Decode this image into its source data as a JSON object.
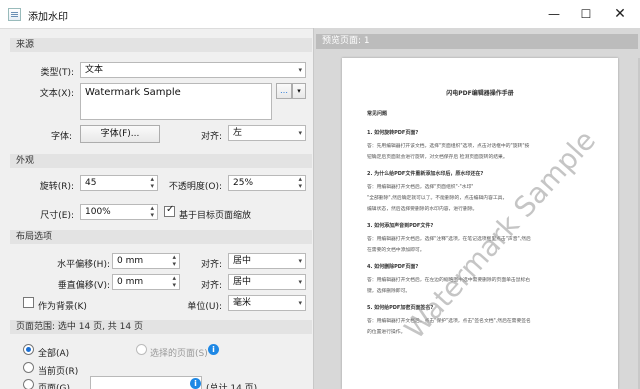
{
  "window": {
    "title": "添加水印"
  },
  "source": {
    "section": "来源",
    "type_label": "类型(T):",
    "type_value": "文本",
    "text_label": "文本(X):",
    "text_value": "Watermark Sample",
    "font_label": "字体:",
    "font_button": "字体(F)...",
    "align_label": "对齐:",
    "align_value": "左"
  },
  "appearance": {
    "section": "外观",
    "rotation_label": "旋转(R):",
    "rotation_value": "45",
    "opacity_label": "不透明度(O):",
    "opacity_value": "25%",
    "size_label": "尺寸(E):",
    "size_value": "100%",
    "relative_label": "基于目标页面缩放",
    "relative_checked": true
  },
  "layout": {
    "section": "布局选项",
    "hoffset_label": "水平偏移(H):",
    "hoffset_value": "0 mm",
    "halign_label": "对齐:",
    "halign_value": "居中",
    "voffset_label": "垂直偏移(V):",
    "voffset_value": "0 mm",
    "valign_label": "对齐:",
    "valign_value": "居中",
    "background_label": "作为背景(K)",
    "background_checked": false,
    "unit_label": "单位(U):",
    "unit_value": "毫米"
  },
  "range": {
    "section": "页面范围: 选中 14 页, 共 14 页",
    "all_label": "全部(A)",
    "selected_label": "选择的页面(S)",
    "current_label": "当前页(R)",
    "pages_label": "页面(G)",
    "pages_total": "(总计 14 页)"
  },
  "preview": {
    "header": "预览页面: 1",
    "watermark": "Watermark Sample",
    "doc_title": "闪电PDF编辑器操作手册",
    "lines": [
      {
        "t": "常见问题",
        "b": true
      },
      {
        "t": "1. 如何旋转PDF页面?",
        "b": true
      },
      {
        "t": "答：先用编辑器打开该文档，选择\"页面组织\"选项，点击对话框中的\"旋转\"按",
        "b": false
      },
      {
        "t": "钮确定后页面就会进行旋转，对文档保存后 检测页面旋转的结果。",
        "b": false
      },
      {
        "t": "2. 为什么给PDF文件重新添加水印后，原水印还在?",
        "b": true
      },
      {
        "t": "答：用编辑器打开文档后，选择\"页面组织\"-\"水印\"",
        "b": false
      },
      {
        "t": "\"全部删除\",然后确定就可以了。不能删除的，点击编辑内容工具，",
        "b": false
      },
      {
        "t": "编辑状态，然后选择要删除的水印内容，进行删除。",
        "b": false
      },
      {
        "t": "3. 如何添加声音到PDF文件?",
        "b": true
      },
      {
        "t": "答：用编辑器打开文档后，选择\"注释\"选项，在笔记选项框里点击\"声音\",然后",
        "b": false
      },
      {
        "t": "在需要的文档中添加即可。",
        "b": false
      },
      {
        "t": "4. 如何删除PDF页面?",
        "b": true
      },
      {
        "t": "答：用编辑器打开文档后，在左边的缩略图中选中需要删除的页面单击鼠标右",
        "b": false
      },
      {
        "t": "键，选择删除即可。",
        "b": false
      },
      {
        "t": "5. 如何给PDF加密页面签名?",
        "b": true
      },
      {
        "t": "答：用编辑器打开文档后，点击\"保护\"选项，点击\"签名文档\",然后在需要签名",
        "b": false
      },
      {
        "t": "的位置进行操作。",
        "b": false
      }
    ]
  },
  "icons": {
    "combo_arrow": "▾",
    "spin_up": "▴",
    "spin_down": "▾",
    "info": "i"
  }
}
